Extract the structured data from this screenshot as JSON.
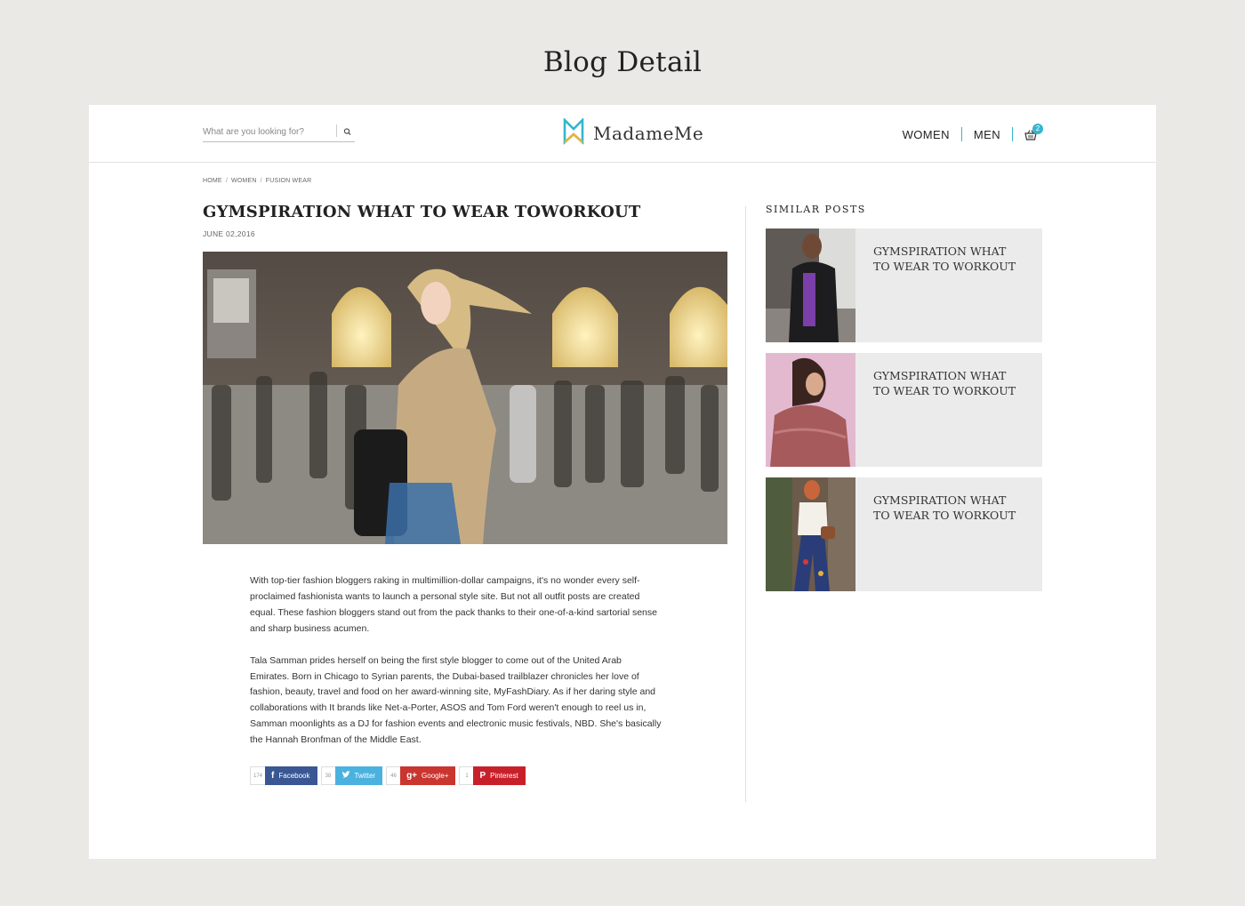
{
  "page_heading": "Blog Detail",
  "header": {
    "search_placeholder": "What are you looking for?",
    "logo_name": "MadameMe",
    "nav": [
      "WOMEN",
      "MEN"
    ],
    "cart_count": "2",
    "accent_color": "#35b6cf"
  },
  "breadcrumb": [
    "HOME",
    "WOMEN",
    "FUSION WEAR"
  ],
  "breadcrumb_sep": "/",
  "article": {
    "title": "GYMSPIRATION WHAT TO WEAR TOWORKOUT",
    "date": "JUNE 02,2016",
    "paragraphs": [
      "With top-tier fashion bloggers raking in multimillion-dollar campaigns, it's no wonder every self-proclaimed fashionista wants to launch a personal style site. But not all outfit posts are created equal. These fashion bloggers stand out from the pack thanks to their one-of-a-kind sartorial sense and sharp business acumen.",
      "Tala Samman prides herself on being the first style blogger to come out of the United Arab Emirates. Born in Chicago to Syrian parents, the Dubai-based trailblazer chronicles her love of fashion, beauty, travel and food on her award-winning site, MyFashDiary. As if her daring style and collaborations with It brands like Net-a-Porter, ASOS and Tom Ford weren't enough to reel us in, Samman moonlights as a DJ for fashion events and electronic music festivals, NBD. She's basically the Hannah Bronfman of the Middle East."
    ]
  },
  "share": {
    "facebook": {
      "count": "174",
      "label": "Facebook",
      "icon": "f"
    },
    "twitter": {
      "count": "38",
      "label": "Twitter",
      "icon": "🐦"
    },
    "googleplus": {
      "count": "46",
      "label": "Google+",
      "icon": "g+"
    },
    "pinterest": {
      "count": "1",
      "label": "Pinterest",
      "icon": "P"
    }
  },
  "similar": {
    "heading": "SIMILAR POSTS",
    "posts": [
      {
        "title": "GYMSPIRATION WHAT TO WEAR TO WORKOUT"
      },
      {
        "title": "GYMSPIRATION WHAT TO WEAR TO WORKOUT"
      },
      {
        "title": "GYMSPIRATION WHAT TO WEAR TO WORKOUT"
      }
    ]
  }
}
